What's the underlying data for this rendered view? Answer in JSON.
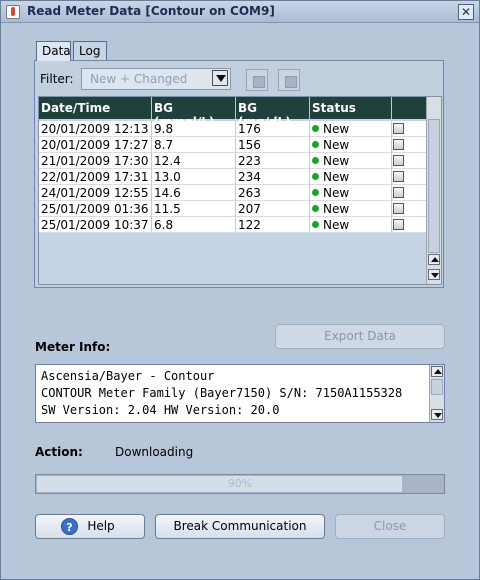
{
  "window": {
    "title": "Read Meter Data  [Contour on COM9]"
  },
  "tabs": [
    {
      "label": "Data"
    },
    {
      "label": "Log"
    }
  ],
  "filter": {
    "label": "Filter:",
    "value": "New + Changed"
  },
  "table": {
    "headers": [
      "Date/Time",
      "BG (mmol/L)",
      "BG (mg/dL)",
      "Status"
    ],
    "rows": [
      {
        "datetime": "20/01/2009 12:13",
        "mmol": "9.8",
        "mgdl": "176",
        "status": "New"
      },
      {
        "datetime": "20/01/2009 17:27",
        "mmol": "8.7",
        "mgdl": "156",
        "status": "New"
      },
      {
        "datetime": "21/01/2009 17:30",
        "mmol": "12.4",
        "mgdl": "223",
        "status": "New"
      },
      {
        "datetime": "22/01/2009 17:31",
        "mmol": "13.0",
        "mgdl": "234",
        "status": "New"
      },
      {
        "datetime": "24/01/2009 12:55",
        "mmol": "14.6",
        "mgdl": "263",
        "status": "New"
      },
      {
        "datetime": "25/01/2009 01:36",
        "mmol": "11.5",
        "mgdl": "207",
        "status": "New"
      },
      {
        "datetime": "25/01/2009 10:37",
        "mmol": "6.8",
        "mgdl": "122",
        "status": "New"
      }
    ]
  },
  "export": {
    "label": "Export Data"
  },
  "meter_info": {
    "label": "Meter Info:",
    "lines": [
      "Ascensia/Bayer - Contour",
      "CONTOUR Meter Family (Bayer7150) S/N: 7150A1155328",
      "SW Version: 2.04  HW Version: 20.0"
    ]
  },
  "action": {
    "label": "Action:",
    "value": "Downloading"
  },
  "progress": {
    "percent": "90%",
    "fraction": 0.9
  },
  "buttons": {
    "help": "Help",
    "break": "Break Communication",
    "close": "Close"
  }
}
